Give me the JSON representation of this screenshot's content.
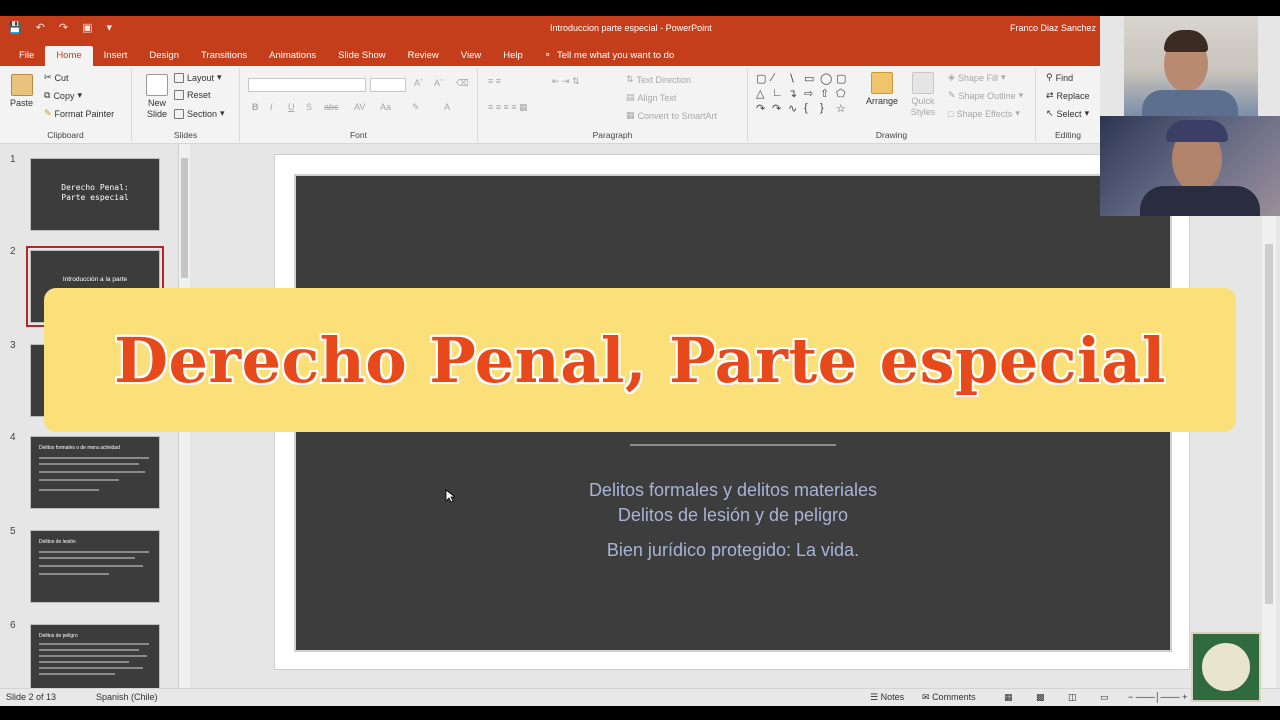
{
  "window": {
    "title": "Introduccion parte especial  -  PowerPoint",
    "user": "Franco Diaz Sanchez"
  },
  "tabs": [
    "File",
    "Home",
    "Insert",
    "Design",
    "Transitions",
    "Animations",
    "Slide Show",
    "Review",
    "View",
    "Help"
  ],
  "tell_me": "Tell me what you want to do",
  "ribbon": {
    "clipboard": {
      "label": "Clipboard",
      "paste": "Paste",
      "cut": "Cut",
      "copy": "Copy",
      "format_painter": "Format Painter"
    },
    "slides": {
      "label": "Slides",
      "new_slide": "New Slide",
      "layout": "Layout",
      "reset": "Reset",
      "section": "Section"
    },
    "font": {
      "label": "Font"
    },
    "paragraph": {
      "label": "Paragraph",
      "text_direction": "Text Direction",
      "align_text": "Align Text",
      "convert_smartart": "Convert to SmartArt"
    },
    "drawing": {
      "label": "Drawing",
      "arrange": "Arrange",
      "quick_styles": "Quick Styles",
      "shape_fill": "Shape Fill",
      "shape_outline": "Shape Outline",
      "shape_effects": "Shape Effects"
    },
    "editing": {
      "label": "Editing",
      "find": "Find",
      "replace": "Replace",
      "select": "Select"
    }
  },
  "thumbnails": [
    {
      "num": "1",
      "title": "Derecho Penal: Parte especial"
    },
    {
      "num": "2",
      "title": "Introducción a la parte"
    },
    {
      "num": "3",
      "title": ""
    },
    {
      "num": "4",
      "title": "Delitos formales o de mera actividad"
    },
    {
      "num": "5",
      "title": "Delitos de lesión"
    },
    {
      "num": "6",
      "title": "Delitos de peligro"
    }
  ],
  "slide": {
    "partial_title": "especial",
    "lines": [
      "Delitos formales y delitos materiales",
      "Delitos de lesión y de peligro",
      "Bien jurídico protegido: La vida."
    ]
  },
  "status": {
    "slide_count": "Slide 2 of 13",
    "language": "Spanish (Chile)",
    "notes": "Notes",
    "comments": "Comments"
  },
  "banner": {
    "text": "Derecho Penal, Parte especial"
  },
  "colors": {
    "accent": "#c43e1c",
    "banner_bg": "#fbe07a",
    "banner_text": "#e8491b",
    "slide_bg": "#3d3d3d",
    "slide_text": "#a8b3d6"
  }
}
